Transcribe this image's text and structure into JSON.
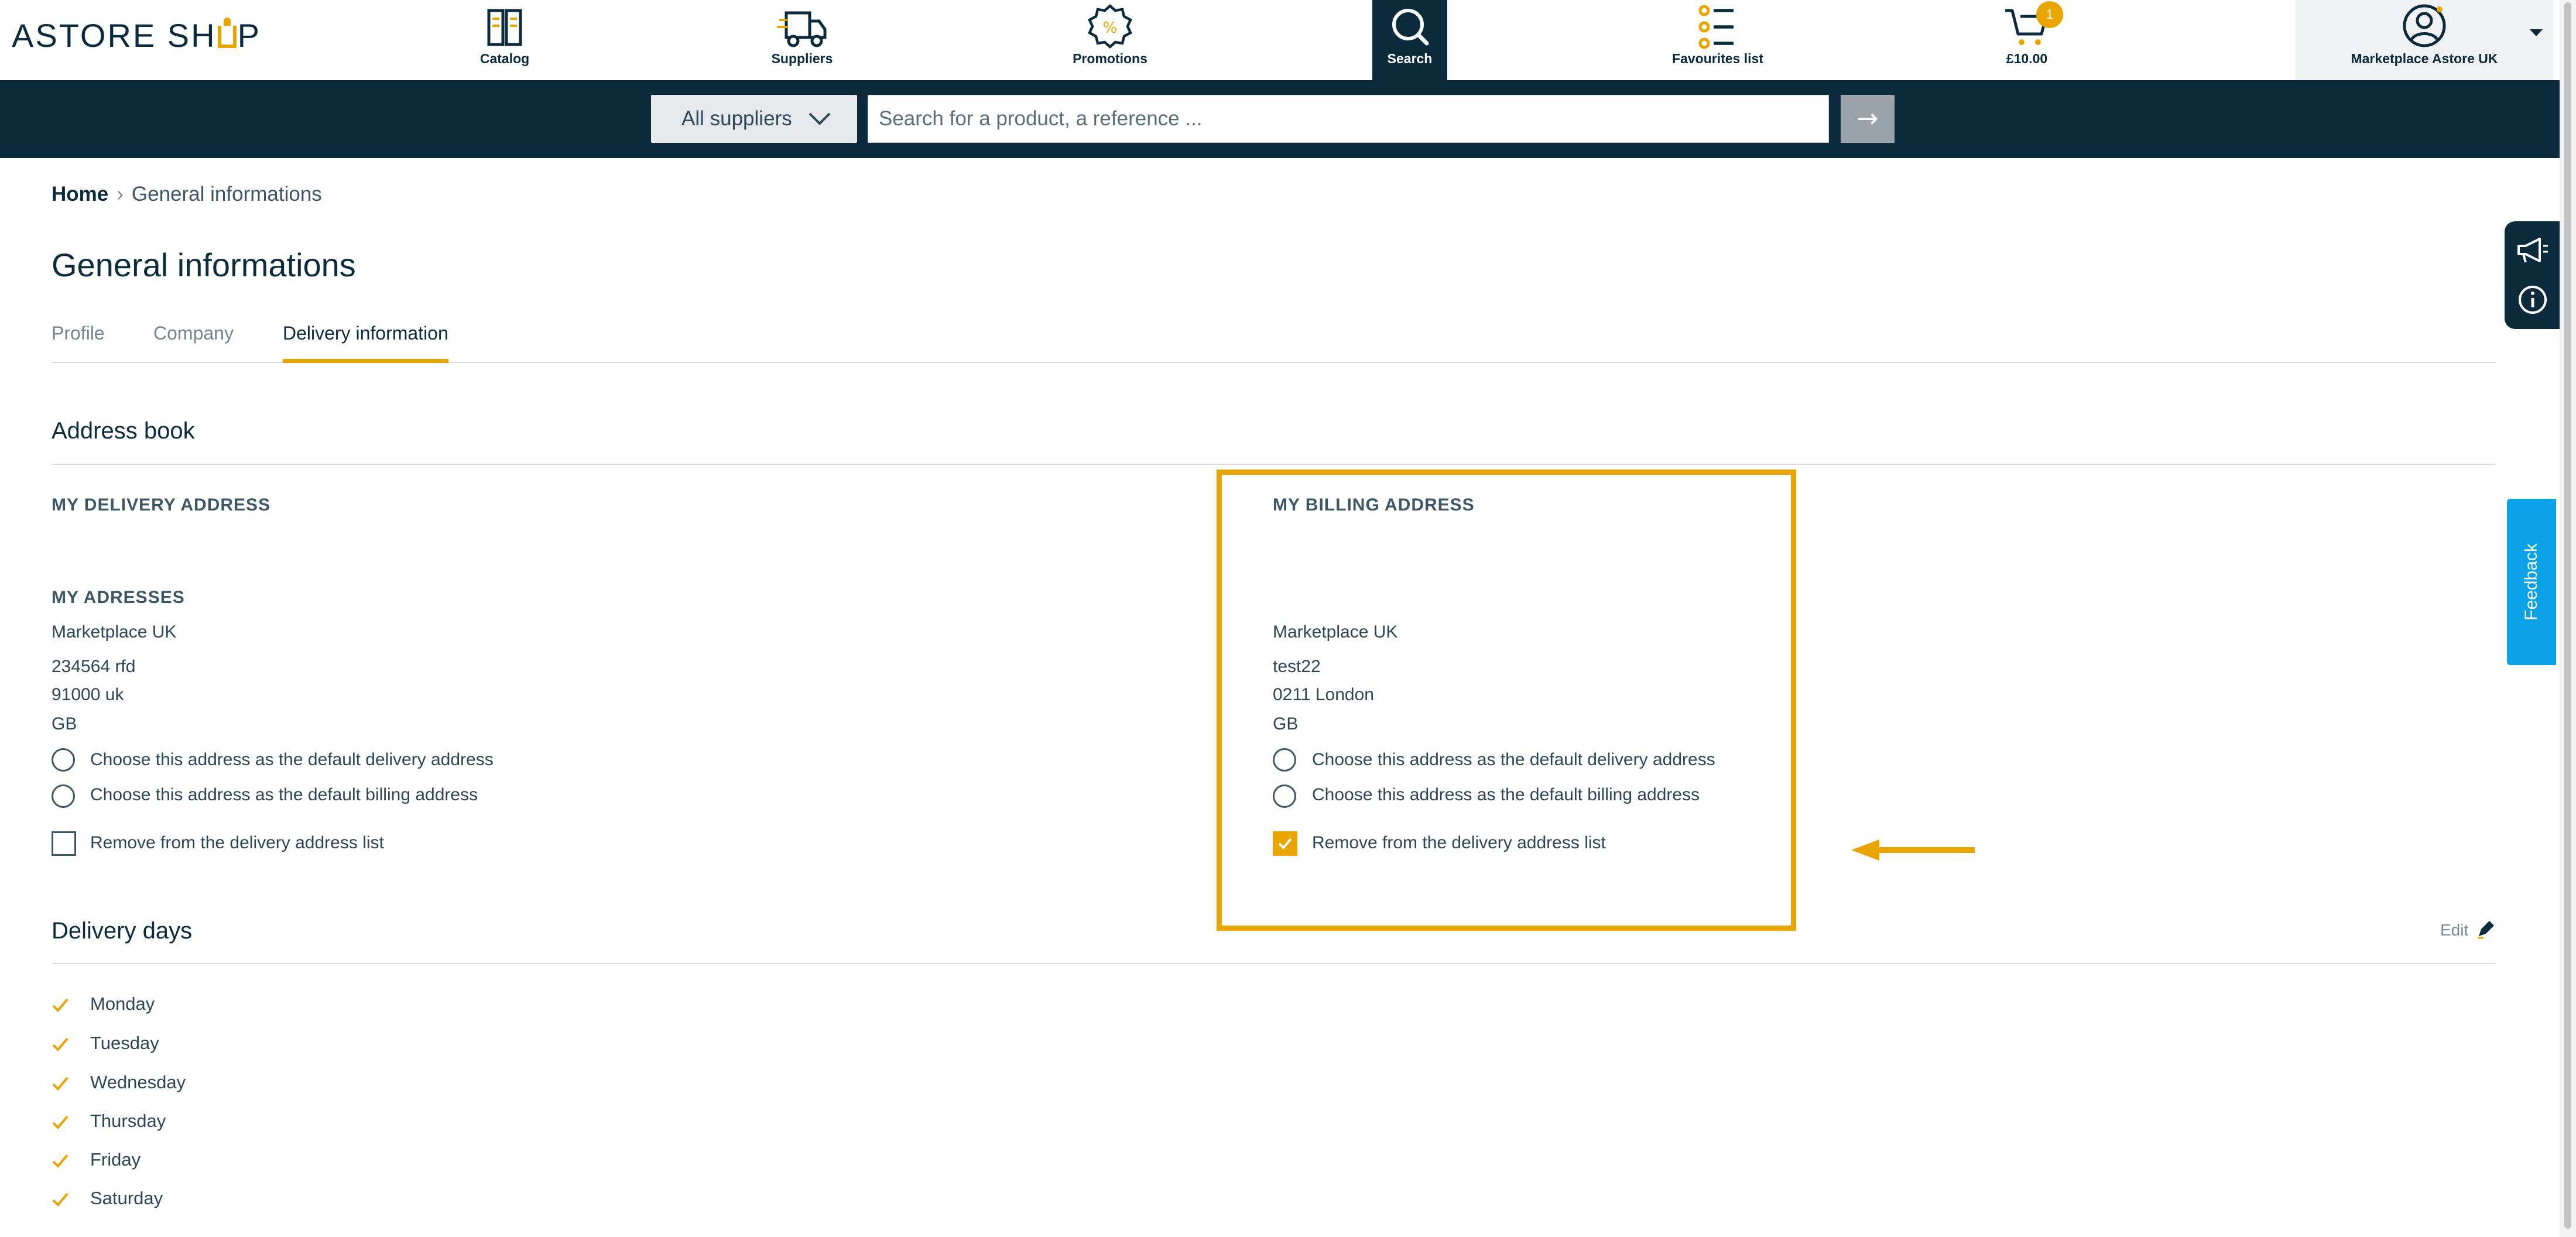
{
  "brand": {
    "logo_before": "ASTORE SH",
    "logo_after": "P"
  },
  "nav": {
    "catalog": "Catalog",
    "suppliers": "Suppliers",
    "promotions": "Promotions",
    "search": "Search",
    "favourites": "Favourites list",
    "cart_total": "£10.00",
    "cart_count": "1",
    "account": "Marketplace Astore UK"
  },
  "searchbar": {
    "supplier_filter": "All suppliers",
    "placeholder": "Search for a product, a reference ...",
    "go": "→"
  },
  "side": {
    "feedback": "Feedback"
  },
  "breadcrumb": {
    "home": "Home",
    "current": "General informations"
  },
  "page": {
    "title": "General informations"
  },
  "tabs": [
    {
      "label": "Profile",
      "active": false
    },
    {
      "label": "Company",
      "active": false
    },
    {
      "label": "Delivery information",
      "active": true
    }
  ],
  "address_book": {
    "title": "Address book",
    "delivery_heading": "MY DELIVERY ADDRESS",
    "billing_heading": "MY BILLING ADDRESS",
    "addresses_heading": "MY ADRESSES",
    "delivery_address": {
      "name": "Marketplace UK",
      "street": "234564 rfd",
      "city": "91000 uk",
      "country": "GB",
      "default_delivery_label": "Choose this address as the default delivery address",
      "default_billing_label": "Choose this address as the default billing address",
      "remove_label": "Remove from the delivery address list",
      "remove_checked": false
    },
    "billing_address": {
      "name": "Marketplace UK",
      "street": "test22",
      "city": "0211 London",
      "country": "GB",
      "default_delivery_label": "Choose this address as the default delivery address",
      "default_billing_label": "Choose this address as the default billing address",
      "remove_label": "Remove from the delivery address list",
      "remove_checked": true
    }
  },
  "delivery_days": {
    "title": "Delivery days",
    "edit": "Edit",
    "days": [
      "Monday",
      "Tuesday",
      "Wednesday",
      "Thursday",
      "Friday",
      "Saturday"
    ]
  },
  "colors": {
    "navy": "#0b2a3c",
    "accent": "#e8a500",
    "feedback": "#0aa1e6"
  }
}
